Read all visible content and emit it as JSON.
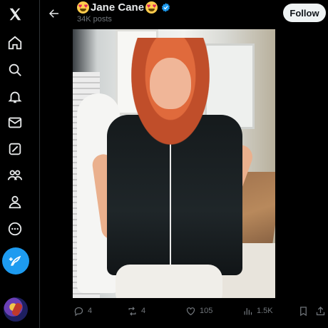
{
  "nav": {
    "items": [
      {
        "icon": "x-logo-icon"
      },
      {
        "icon": "home-icon"
      },
      {
        "icon": "search-icon"
      },
      {
        "icon": "bell-icon"
      },
      {
        "icon": "mail-icon"
      },
      {
        "icon": "grok-icon"
      },
      {
        "icon": "communities-icon"
      },
      {
        "icon": "profile-icon"
      },
      {
        "icon": "more-icon"
      }
    ],
    "compose_icon": "compose-icon"
  },
  "header": {
    "name": "Jane Cane",
    "posts_count": "34K posts",
    "follow_label": "Follow"
  },
  "actions": {
    "replies": "4",
    "reposts": "4",
    "likes": "105",
    "views": "1.5K"
  },
  "colors": {
    "accent": "#1d9bf0",
    "background": "#000000",
    "text": "#e7e9ea",
    "secondary": "#71767b"
  }
}
